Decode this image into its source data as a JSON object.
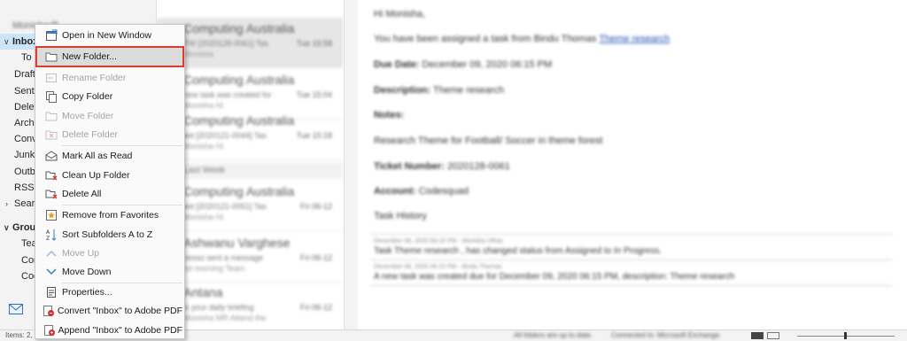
{
  "folder_pane": {
    "account": "Monisha@...",
    "inbox": "Inbox",
    "items": [
      "To Do",
      "Drafts",
      "Sent I",
      "Delete",
      "Archi",
      "Conv",
      "Junk I",
      "Outb",
      "RSS S",
      "Searc"
    ],
    "groups_label": "Group",
    "group_items": [
      "Tear",
      "Cor",
      "Coo"
    ]
  },
  "message_list": {
    "messages": [
      {
        "from": "Computing Australia",
        "line1": "FW [2020128-0061] Tas",
        "line2": "Monisha",
        "time": "Tue 15:58"
      },
      {
        "from": "Computing Australia",
        "line1": "new task was created for",
        "line2": "Monisha Hi",
        "time": "Tue 15:04"
      },
      {
        "from": "Computing Australia",
        "line1": "ket [2020121-0044] Tas",
        "line2": "Monisha Hi",
        "time": "Tue 15:18"
      },
      {
        "from": "Computing Australia",
        "line1": "ket [2020121-0051] Tas",
        "line2": "Monisha Hi",
        "time": "Fri 06-12"
      },
      {
        "from": "Ashwanu Varghese",
        "line1": "nesso sent a message",
        "line2": "od morning Team",
        "time": "Fri 06-12"
      },
      {
        "from": "Antana",
        "line1": "is your daily briefing",
        "line2": "Monisha MR   Attend the",
        "time": "Fri 06-12"
      }
    ],
    "group_header": "Last Week"
  },
  "reading_pane": {
    "greeting": "Hi Monisha,",
    "assigned_prefix": "You have been assigned a task from Bindu Thomas",
    "assigned_link": "Theme research",
    "due_label": "Due Date:",
    "due_value": "December 09, 2020 06:15 PM",
    "desc_label": "Description:",
    "desc_value": "Theme research",
    "notes_label": "Notes:",
    "notes_value": "Research Theme for Football/ Soccer in theme forest",
    "ticket_label": "Ticket Number:",
    "ticket_value": "2020128-0061",
    "account_label": "Account:",
    "account_value": "Codesquad",
    "history_label": "Task History",
    "history": [
      {
        "meta": "December 08, 2020 06:15 PM - Monisha Ulhas",
        "text": "Task Theme research , has changed status from Assigned to In Progress."
      },
      {
        "meta": "December 08, 2020 06:15 PM - Bindu Thomas",
        "text": "A new task was created due for December 09, 2020 06:15 PM, description: Theme research"
      }
    ]
  },
  "status_bar": {
    "items": "Items: 2,",
    "sync": "All folders are up to date.",
    "connection": "Connected to: Microsoft Exchange"
  },
  "context_menu": {
    "items": [
      {
        "label": "Open in New Window",
        "icon": "open-window-icon",
        "disabled": false
      },
      {
        "label": "New Folder...",
        "icon": "new-folder-icon",
        "disabled": false,
        "highlighted": true
      },
      {
        "label": "Rename Folder",
        "icon": "rename-folder-icon",
        "disabled": true
      },
      {
        "label": "Copy Folder",
        "icon": "copy-folder-icon",
        "disabled": false
      },
      {
        "label": "Move Folder",
        "icon": "move-folder-icon",
        "disabled": true
      },
      {
        "label": "Delete Folder",
        "icon": "delete-folder-icon",
        "disabled": true
      },
      {
        "label": "Mark All as Read",
        "icon": "mark-read-icon",
        "disabled": false
      },
      {
        "label": "Clean Up Folder",
        "icon": "clean-up-icon",
        "disabled": false
      },
      {
        "label": "Delete All",
        "icon": "delete-all-icon",
        "disabled": false
      },
      {
        "label": "Remove from Favorites",
        "icon": "favorites-star-icon",
        "disabled": false
      },
      {
        "label": "Sort Subfolders A to Z",
        "icon": "sort-az-icon",
        "disabled": false
      },
      {
        "label": "Move Up",
        "icon": "chevron-up-icon",
        "disabled": true
      },
      {
        "label": "Move Down",
        "icon": "chevron-down-icon",
        "disabled": false
      },
      {
        "label": "Properties...",
        "icon": "properties-icon",
        "disabled": false
      },
      {
        "label": "Convert \"Inbox\" to Adobe PDF",
        "icon": "pdf-convert-icon",
        "disabled": false
      },
      {
        "label": "Append \"Inbox\" to Adobe PDF",
        "icon": "pdf-append-icon",
        "disabled": false
      }
    ]
  },
  "colors": {
    "highlight_border": "#e03a2e",
    "link": "#1f4fb5",
    "selection": "#cde6f7"
  }
}
